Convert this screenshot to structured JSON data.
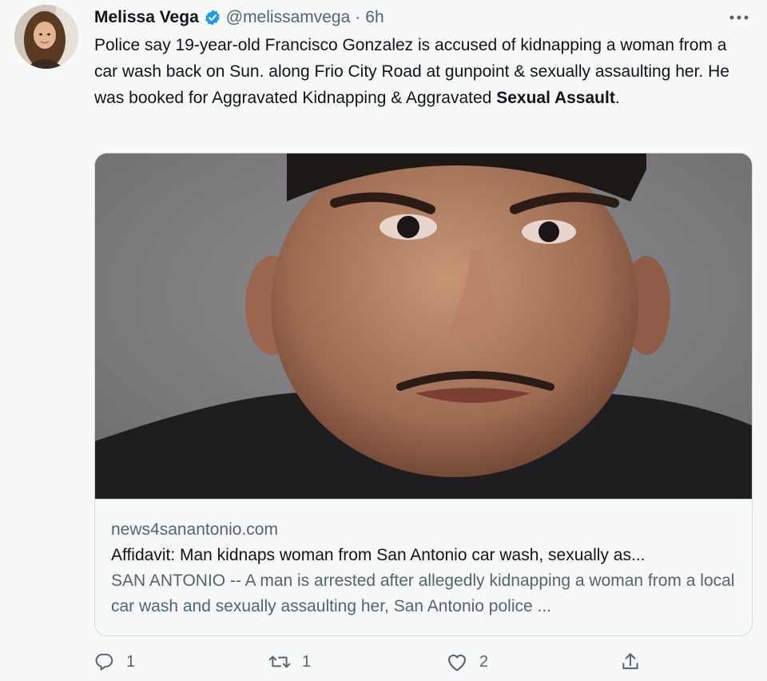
{
  "author": {
    "display_name": "Melissa Vega",
    "handle": "@melissamvega",
    "separator": "·",
    "time": "6h",
    "avatar_icon": "profile-photo",
    "verified_icon": "verified-badge-icon",
    "verified_color": "#1d9bf0"
  },
  "more_icon": "more-dots-icon",
  "tweet": {
    "text_before": "Police say 19-year-old Francisco Gonzalez is accused of kidnapping a woman from a car wash back on Sun. along Frio City Road at gunpoint & sexually assaulting her. He was booked for Aggravated Kidnapping & Aggravated ",
    "text_bold": "Sexual Assault",
    "text_after": "."
  },
  "card": {
    "image_icon": "mugshot-photo",
    "domain": "news4sanantonio.com",
    "title": "Affidavit: Man kidnaps woman from San Antonio car wash, sexually as...",
    "description": "SAN ANTONIO -- A man is arrested after allegedly kidnapping a woman from a local car wash and sexually assaulting her, San Antonio police ..."
  },
  "actions": {
    "reply": {
      "icon": "reply-icon",
      "count": "1"
    },
    "retweet": {
      "icon": "retweet-icon",
      "count": "1"
    },
    "like": {
      "icon": "like-icon",
      "count": "2"
    },
    "share": {
      "icon": "share-icon"
    }
  },
  "colors": {
    "text_primary": "#0f1419",
    "text_secondary": "#536471",
    "border": "#cfd9de",
    "background": "#f7f9f9"
  }
}
